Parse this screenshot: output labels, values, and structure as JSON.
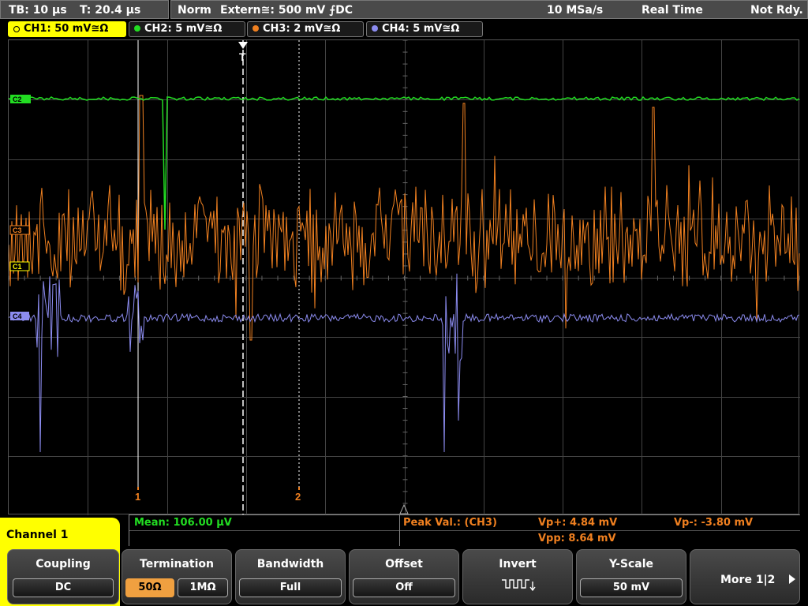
{
  "topbar": {
    "timebase": "TB: 10 µs",
    "trigger_time": "T: 20.4 µs",
    "trigger_mode": "Norm",
    "trigger_source": "Extern≅: 500 mV ⨍DC",
    "sample_rate": "10 MSa/s",
    "acq_mode": "Real Time",
    "status": "Not Rdy."
  },
  "channels": [
    {
      "label": "CH1: 50 mV≅Ω",
      "color": "#ffff00"
    },
    {
      "label": "CH2: 5 mV≅Ω",
      "color": "#22dd22"
    },
    {
      "label": "CH3: 2 mV≅Ω",
      "color": "#f08020"
    },
    {
      "label": "CH4: 5 mV≅Ω",
      "color": "#8c8cf0"
    }
  ],
  "markers": {
    "ch2": "C2",
    "ch3": "C3",
    "ch1": "C1",
    "ch4": "C4",
    "cursor1": "1",
    "cursor2": "2",
    "trigger": "T"
  },
  "measurements": {
    "mean": "Mean: 106.00 µV",
    "peak_label": "Peak Val.:  (CH3)",
    "vp_plus": "Vp+: 4.84 mV",
    "vp_minus": "Vp-: -3.80 mV",
    "vpp": "Vpp: 8.64 mV"
  },
  "menu": {
    "title": "Channel 1"
  },
  "softkeys": {
    "coupling": {
      "title": "Coupling",
      "value": "DC"
    },
    "termination": {
      "title": "Termination",
      "opt1": "50Ω",
      "opt2": "1MΩ"
    },
    "bandwidth": {
      "title": "Bandwidth",
      "value": "Full"
    },
    "offset": {
      "title": "Offset",
      "value": "Off"
    },
    "invert": {
      "title": "Invert"
    },
    "yscale": {
      "title": "Y-Scale",
      "value": "50 mV"
    },
    "more": {
      "label": "More 1|2"
    }
  },
  "colors": {
    "ch1": "#ffff00",
    "ch2": "#22dd22",
    "ch3": "#f08020",
    "ch4": "#8c8cf0",
    "grid": "#555555",
    "measure_green": "#22dd22",
    "measure_orange": "#f08020"
  }
}
